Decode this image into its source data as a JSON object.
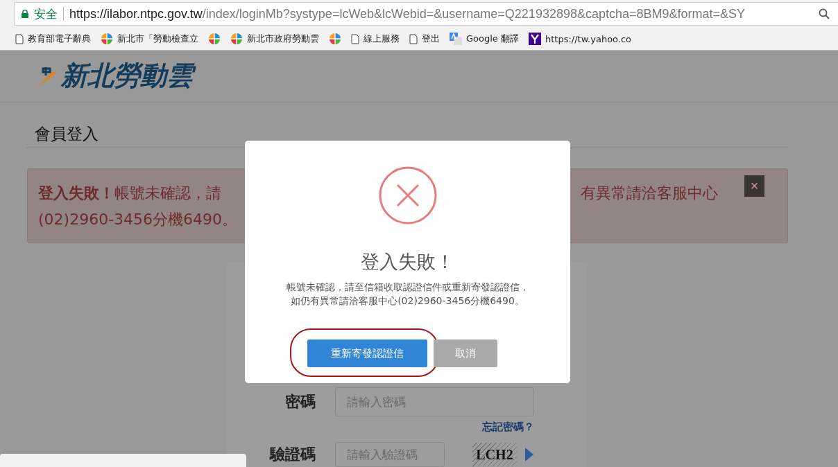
{
  "address_bar": {
    "security_label": "安全",
    "url_host": "https://ilabor.ntpc.gov.tw",
    "url_rest": "/index/loginMb?systype=lcWeb&lcWebid=&username=Q221932898&captcha=8BM9&format=&SY"
  },
  "bookmarks": [
    {
      "kind": "page",
      "label": "教育部電子辭典"
    },
    {
      "kind": "site",
      "label": "新北市「勞動檢查立"
    },
    {
      "kind": "site"
    },
    {
      "kind": "site",
      "label": "新北市政府勞動雲"
    },
    {
      "kind": "site"
    },
    {
      "kind": "page",
      "label": "線上服務"
    },
    {
      "kind": "page",
      "label": "登出"
    },
    {
      "kind": "translate",
      "label": "Google 翻譯"
    },
    {
      "kind": "yahoo",
      "label": "https://tw.yahoo.co"
    }
  ],
  "header": {
    "logo_text": "新北勞動雲"
  },
  "heading": "會員登入",
  "alert": {
    "title": "登入失敗！",
    "text_left": "帳號未確認，請",
    "text_right": "有異常請洽客服中心",
    "text_line2": "(02)2960-3456分機6490。",
    "close": "×"
  },
  "login_form": {
    "password": {
      "label": "密碼",
      "placeholder": "請輸入密碼"
    },
    "forgot_link": "忘記密碼？",
    "captcha": {
      "label": "驗證碼",
      "placeholder": "請輸入驗證碼",
      "image_text": "LCH2"
    }
  },
  "modal": {
    "title": "登入失敗！",
    "message_lines": [
      "帳號未確認，請至信箱收取認證信件或重新寄發認證信，",
      "如仍有異常請洽客服中心(02)2960-3456分機6490。"
    ],
    "buttons": [
      {
        "label": "重新寄發認證信",
        "kind": "primary",
        "highlighted": true
      },
      {
        "label": "取消",
        "kind": "secondary",
        "highlighted": false
      }
    ]
  }
}
